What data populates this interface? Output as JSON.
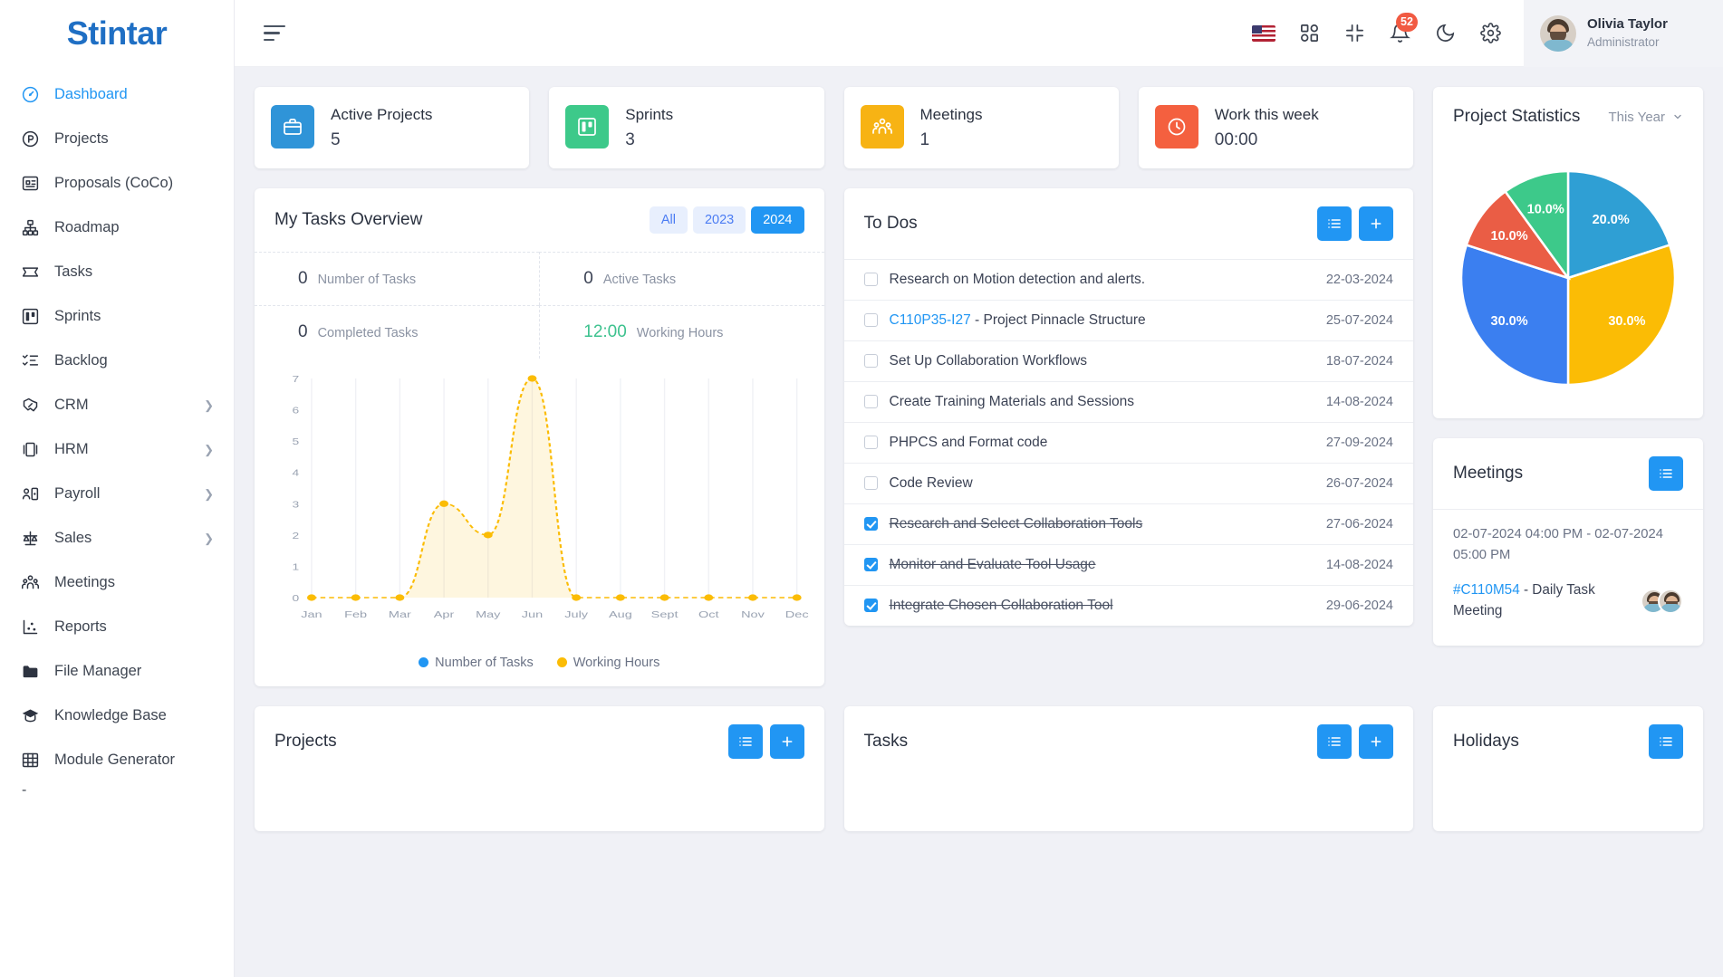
{
  "brand": {
    "name": "Stintar"
  },
  "sidebar": {
    "items": [
      {
        "label": "Dashboard",
        "icon": "speedometer-icon",
        "active": true,
        "expandable": false
      },
      {
        "label": "Projects",
        "icon": "circle-p-icon",
        "active": false,
        "expandable": false
      },
      {
        "label": "Proposals (CoCo)",
        "icon": "proposal-icon",
        "active": false,
        "expandable": false
      },
      {
        "label": "Roadmap",
        "icon": "sitemap-icon",
        "active": false,
        "expandable": false
      },
      {
        "label": "Tasks",
        "icon": "ticket-icon",
        "active": false,
        "expandable": false
      },
      {
        "label": "Sprints",
        "icon": "board-icon",
        "active": false,
        "expandable": false
      },
      {
        "label": "Backlog",
        "icon": "checklist-icon",
        "active": false,
        "expandable": false
      },
      {
        "label": "CRM",
        "icon": "handshake-icon",
        "active": false,
        "expandable": true
      },
      {
        "label": "HRM",
        "icon": "id-card-icon",
        "active": false,
        "expandable": true
      },
      {
        "label": "Payroll",
        "icon": "person-card-icon",
        "active": false,
        "expandable": true
      },
      {
        "label": "Sales",
        "icon": "scales-icon",
        "active": false,
        "expandable": true
      },
      {
        "label": "Meetings",
        "icon": "people-icon",
        "active": false,
        "expandable": false
      },
      {
        "label": "Reports",
        "icon": "scatter-chart-icon",
        "active": false,
        "expandable": false
      },
      {
        "label": "File Manager",
        "icon": "folder-icon",
        "active": false,
        "expandable": false
      },
      {
        "label": "Knowledge Base",
        "icon": "graduation-cap-icon",
        "active": false,
        "expandable": false
      },
      {
        "label": "Module Generator",
        "icon": "grid-table-icon",
        "active": false,
        "expandable": false
      }
    ],
    "trailing_label": "-"
  },
  "topbar": {
    "menu_icon": "hamburger-icon",
    "language_icon": "us-flag-icon",
    "apps_icon": "grid-apps-icon",
    "fullscreen_icon": "collapse-screen-icon",
    "notification_icon": "bell-icon",
    "notification_count": "52",
    "dark_mode_icon": "moon-icon",
    "settings_icon": "gear-icon",
    "user": {
      "name": "Olivia Taylor",
      "role": "Administrator"
    }
  },
  "stats": [
    {
      "title": "Active Projects",
      "value": "5",
      "icon": "briefcase-icon",
      "color": "#2f94d8"
    },
    {
      "title": "Sprints",
      "value": "3",
      "icon": "board-icon",
      "color": "#3dc98a"
    },
    {
      "title": "Meetings",
      "value": "1",
      "icon": "people-icon",
      "color": "#f7b314"
    },
    {
      "title": "Work this week",
      "value": "00:00",
      "icon": "clock-icon",
      "color": "#f4603f"
    }
  ],
  "tasks_overview": {
    "title": "My Tasks Overview",
    "filters": [
      {
        "label": "All",
        "active": false
      },
      {
        "label": "2023",
        "active": false
      },
      {
        "label": "2024",
        "active": true
      }
    ],
    "metrics": [
      {
        "value": "0",
        "label": "Number of Tasks",
        "highlight": false
      },
      {
        "value": "0",
        "label": "Active Tasks",
        "highlight": false
      },
      {
        "value": "0",
        "label": "Completed Tasks",
        "highlight": false
      },
      {
        "value": "12:00",
        "label": "Working Hours",
        "highlight": true
      }
    ]
  },
  "chart_data": [
    {
      "type": "area",
      "title": "My Tasks Overview",
      "categories": [
        "Jan",
        "Feb",
        "Mar",
        "Apr",
        "May",
        "Jun",
        "July",
        "Aug",
        "Sept",
        "Oct",
        "Nov",
        "Dec"
      ],
      "series": [
        {
          "name": "Number of Tasks",
          "color": "#2196f3",
          "values": [
            0,
            0,
            0,
            0,
            0,
            0,
            0,
            0,
            0,
            0,
            0,
            0
          ]
        },
        {
          "name": "Working Hours",
          "color": "#fbbc05",
          "values": [
            0,
            0,
            0,
            3,
            2,
            7,
            0,
            0,
            0,
            0,
            0,
            0
          ]
        }
      ],
      "xlabel": "",
      "ylabel": "",
      "ylim": [
        0,
        7
      ],
      "yticks": [
        "0",
        "1",
        "2",
        "3",
        "4",
        "5",
        "6",
        "7"
      ],
      "grid": true,
      "legend_position": "bottom"
    },
    {
      "type": "pie",
      "title": "Project Statistics",
      "period": "This Year",
      "labels": [
        "20.0%",
        "30.0%",
        "30.0%",
        "10.0%",
        "10.0%"
      ],
      "values": [
        20.0,
        30.0,
        30.0,
        10.0,
        10.0
      ],
      "colors": [
        "#2f9fd4",
        "#fbbc05",
        "#3b7ff0",
        "#ea5d45",
        "#3dc98a"
      ],
      "legend_position": "none"
    }
  ],
  "todos": {
    "title": "To Dos",
    "list_icon": "list-icon",
    "add_icon": "plus-icon",
    "items": [
      {
        "code": "",
        "text": "Research on Motion detection and alerts.",
        "date": "22-03-2024",
        "done": false
      },
      {
        "code": "C110P35-I27",
        "text": " - Project Pinnacle Structure",
        "date": "25-07-2024",
        "done": false
      },
      {
        "code": "",
        "text": "Set Up Collaboration Workflows",
        "date": "18-07-2024",
        "done": false
      },
      {
        "code": "",
        "text": "Create Training Materials and Sessions",
        "date": "14-08-2024",
        "done": false
      },
      {
        "code": "",
        "text": "PHPCS and Format code",
        "date": "27-09-2024",
        "done": false
      },
      {
        "code": "",
        "text": "Code Review",
        "date": "26-07-2024",
        "done": false
      },
      {
        "code": "",
        "text": "Research and Select Collaboration Tools",
        "date": "27-06-2024",
        "done": true
      },
      {
        "code": "",
        "text": "Monitor and Evaluate Tool Usage",
        "date": "14-08-2024",
        "done": true
      },
      {
        "code": "",
        "text": "Integrate Chosen Collaboration Tool",
        "date": "29-06-2024",
        "done": true
      }
    ]
  },
  "project_statistics": {
    "title": "Project Statistics",
    "period": "This Year",
    "chevron": "chevron-down-icon"
  },
  "meetings_panel": {
    "title": "Meetings",
    "list_icon": "list-icon",
    "time_range": "02-07-2024 04:00 PM - 02-07-2024 05:00 PM",
    "code": "#C110M54",
    "subject": " - Daily Task Meeting"
  },
  "bottom_panels": [
    {
      "title": "Projects",
      "list_icon": "list-icon",
      "add_icon": "plus-icon",
      "has_add": true
    },
    {
      "title": "Tasks",
      "list_icon": "list-icon",
      "add_icon": "plus-icon",
      "has_add": true
    },
    {
      "title": "Holidays",
      "list_icon": "list-icon",
      "add_icon": "",
      "has_add": false
    }
  ]
}
